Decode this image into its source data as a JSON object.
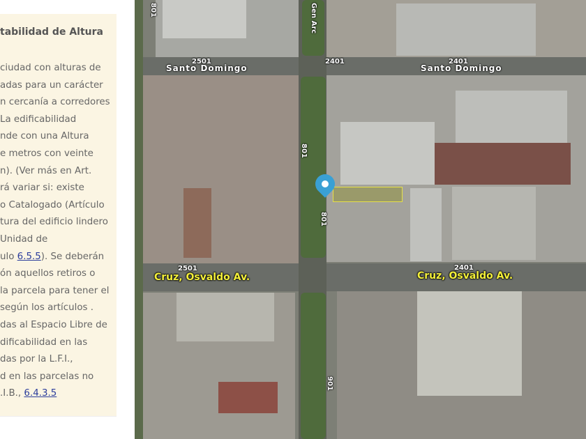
{
  "panel": {
    "title": "tabilidad de Altura",
    "lines": [
      "ciudad con alturas de",
      "adas para un carácter",
      "n cercanía a corredores",
      "La edificabilidad",
      "nde con una Altura",
      "e metros con veinte",
      "n). (Ver más en Art.",
      "rá variar si: existe",
      "o Catalogado (Artículo",
      "tura del edificio lindero",
      "Unidad de"
    ],
    "line_link_prefix": "ulo ",
    "link_1": "6.5.5",
    "line_link_suffix": "). Se deberán",
    "lines2": [
      "ón aquellos retiros o",
      "la parcela para tener el",
      " según los artículos .",
      "das al Espacio Libre de",
      "dificabilidad en las",
      "das por la L.F.I.,",
      "d en las parcelas no"
    ],
    "last_prefix": ".I.B., ",
    "link_2": "6.4.3.5"
  },
  "map": {
    "labels": {
      "top_left_num": "801",
      "gen_arc": "Gen Arc",
      "sd_num_1": "2501",
      "sd_num_2": "2401",
      "sd_num_3": "2401",
      "sd_name_1": "Santo Domingo",
      "sd_name_2": "Santo Domingo",
      "mid_num_1": "801",
      "mid_num_2": "801",
      "cruz_num_1": "2501",
      "cruz_num_2": "2401",
      "cruz_name_1": "Cruz, Osvaldo Av.",
      "cruz_name_2": "Cruz, Osvaldo Av.",
      "bottom_num": "901"
    },
    "pin_color": "#3aa0d4"
  }
}
